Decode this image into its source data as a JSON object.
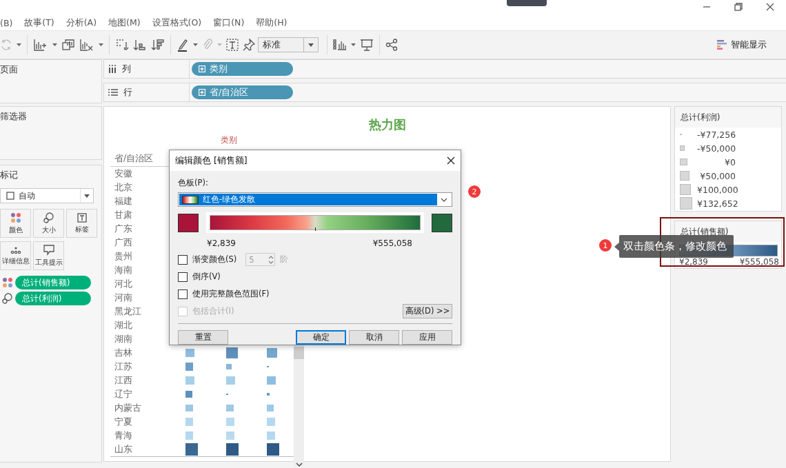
{
  "menu": [
    {
      "label": "(B)"
    },
    {
      "label": "故事(T)"
    },
    {
      "label": "分析(A)"
    },
    {
      "label": "地图(M)"
    },
    {
      "label": "设置格式(O)"
    },
    {
      "label": "窗口(N)"
    },
    {
      "label": "帮助(H)"
    }
  ],
  "toolbar": {
    "mark_type": "标准",
    "show_me": "智能显示"
  },
  "pages_panel": {
    "title": "页面"
  },
  "filters_panel": {
    "title": "筛选器"
  },
  "marks_panel": {
    "title": "标记",
    "mark_type": "自动",
    "cards": [
      {
        "label": "颜色",
        "kind": "color"
      },
      {
        "label": "大小",
        "kind": "size"
      },
      {
        "label": "标签",
        "kind": "label"
      },
      {
        "label": "详细信息",
        "kind": "detail"
      },
      {
        "label": "工具提示",
        "kind": "tooltip"
      }
    ],
    "fields": [
      {
        "label": "总计(销售额)",
        "kind": "color"
      },
      {
        "label": "总计(利润)",
        "kind": "size"
      }
    ]
  },
  "shelves": [
    {
      "label": "列",
      "kind": "columns",
      "pill": "类别"
    },
    {
      "label": "行",
      "kind": "rows",
      "pill": "省/自治区"
    }
  ],
  "view": {
    "title": "热力图",
    "column_header": "类别",
    "row_header": "省/自治区",
    "rows": [
      {
        "name": "安徽"
      },
      {
        "name": "北京"
      },
      {
        "name": "福建"
      },
      {
        "name": "甘肃"
      },
      {
        "name": "广东"
      },
      {
        "name": "广西"
      },
      {
        "name": "贵州"
      },
      {
        "name": "海南"
      },
      {
        "name": "河北"
      },
      {
        "name": "河南"
      },
      {
        "name": "黑龙江"
      },
      {
        "name": "湖北"
      },
      {
        "name": "湖南"
      },
      {
        "name": "吉林",
        "cells": [
          {
            "level": 0.72,
            "color": "#8fbde0"
          },
          {
            "level": 0.9,
            "color": "#5f90bb"
          },
          {
            "level": 0.78,
            "color": "#74a8cf"
          }
        ]
      },
      {
        "name": "江苏",
        "cells": [
          {
            "level": 0.62,
            "color": "#6e9fc8"
          },
          {
            "level": 0.45,
            "color": "#8ab6da"
          },
          {
            "level": 0.12,
            "color": "#6b9bc6"
          }
        ]
      },
      {
        "name": "江西",
        "cells": [
          {
            "level": 0.68,
            "color": "#a6d0ea"
          },
          {
            "level": 0.68,
            "color": "#a6d0ea"
          },
          {
            "level": 0.68,
            "color": "#8fbde0"
          }
        ]
      },
      {
        "name": "辽宁",
        "cells": [
          {
            "level": 0.52,
            "color": "#5e90bd"
          },
          {
            "level": 0.12,
            "color": "#6b9bc6"
          },
          {
            "level": 0.22,
            "color": "#6b9bc6"
          }
        ]
      },
      {
        "name": "内蒙古",
        "cells": [
          {
            "level": 0.57,
            "color": "#9cc8e4"
          },
          {
            "level": 0.57,
            "color": "#9ecae6"
          },
          {
            "level": 0.52,
            "color": "#9ecae6"
          }
        ]
      },
      {
        "name": "宁夏",
        "cells": [
          {
            "level": 0.62,
            "color": "#b4d8ef"
          },
          {
            "level": 0.62,
            "color": "#b8dbf0"
          },
          {
            "level": 0.62,
            "color": "#b4d8ef"
          }
        ]
      },
      {
        "name": "青海",
        "cells": [
          {
            "level": 0.62,
            "color": "#b4d8ef"
          },
          {
            "level": 0.62,
            "color": "#b8dbf0"
          },
          {
            "level": 0.62,
            "color": "#b4d8ef"
          }
        ]
      },
      {
        "name": "山东",
        "cells": [
          {
            "level": 1,
            "color": "#3a6892"
          },
          {
            "level": 1,
            "color": "#2f5a85"
          },
          {
            "level": 1,
            "color": "#2f5a85"
          }
        ]
      }
    ]
  },
  "profit_legend": {
    "title": "总计(利润)",
    "items": [
      {
        "label": "-¥77,256",
        "level": 0.15
      },
      {
        "label": "-¥50,000",
        "level": 0.4
      },
      {
        "label": "¥0",
        "level": 0.6
      },
      {
        "label": "¥50,000",
        "level": 0.8
      },
      {
        "label": "¥100,000",
        "level": 0.9
      },
      {
        "label": "¥132,652",
        "level": 1
      }
    ]
  },
  "sales_legend": {
    "title": "总计(销售额)",
    "min": "¥2,839",
    "max": "¥555,058",
    "highlighted": true
  },
  "dialog": {
    "title": "编辑颜色 [销售额]",
    "palette_label": "色板(P):",
    "palette": "红色-绿色发散",
    "min": "¥2,839",
    "max": "¥555,058",
    "options": [
      {
        "label": "渐变颜色(S)",
        "checked": false,
        "disabled": false,
        "kind": "stepped"
      },
      {
        "label": "倒序(V)",
        "checked": false,
        "disabled": false,
        "kind": "plain"
      },
      {
        "label": "使用完整颜色范围(F)",
        "checked": false,
        "disabled": false,
        "kind": "plain"
      },
      {
        "label": "包括合计(I)",
        "checked": false,
        "disabled": true,
        "kind": "plain"
      }
    ],
    "steps": "5",
    "steps_unit": "阶",
    "advanced": "高级(D) >>",
    "buttons": [
      {
        "label": "重置",
        "default": false
      },
      {
        "label": "确定",
        "default": true
      },
      {
        "label": "取消",
        "default": false
      },
      {
        "label": "应用",
        "default": false
      }
    ]
  },
  "callouts": [
    {
      "number": "1",
      "text": "双击颜色条，修改颜色"
    },
    {
      "number": "2"
    }
  ]
}
